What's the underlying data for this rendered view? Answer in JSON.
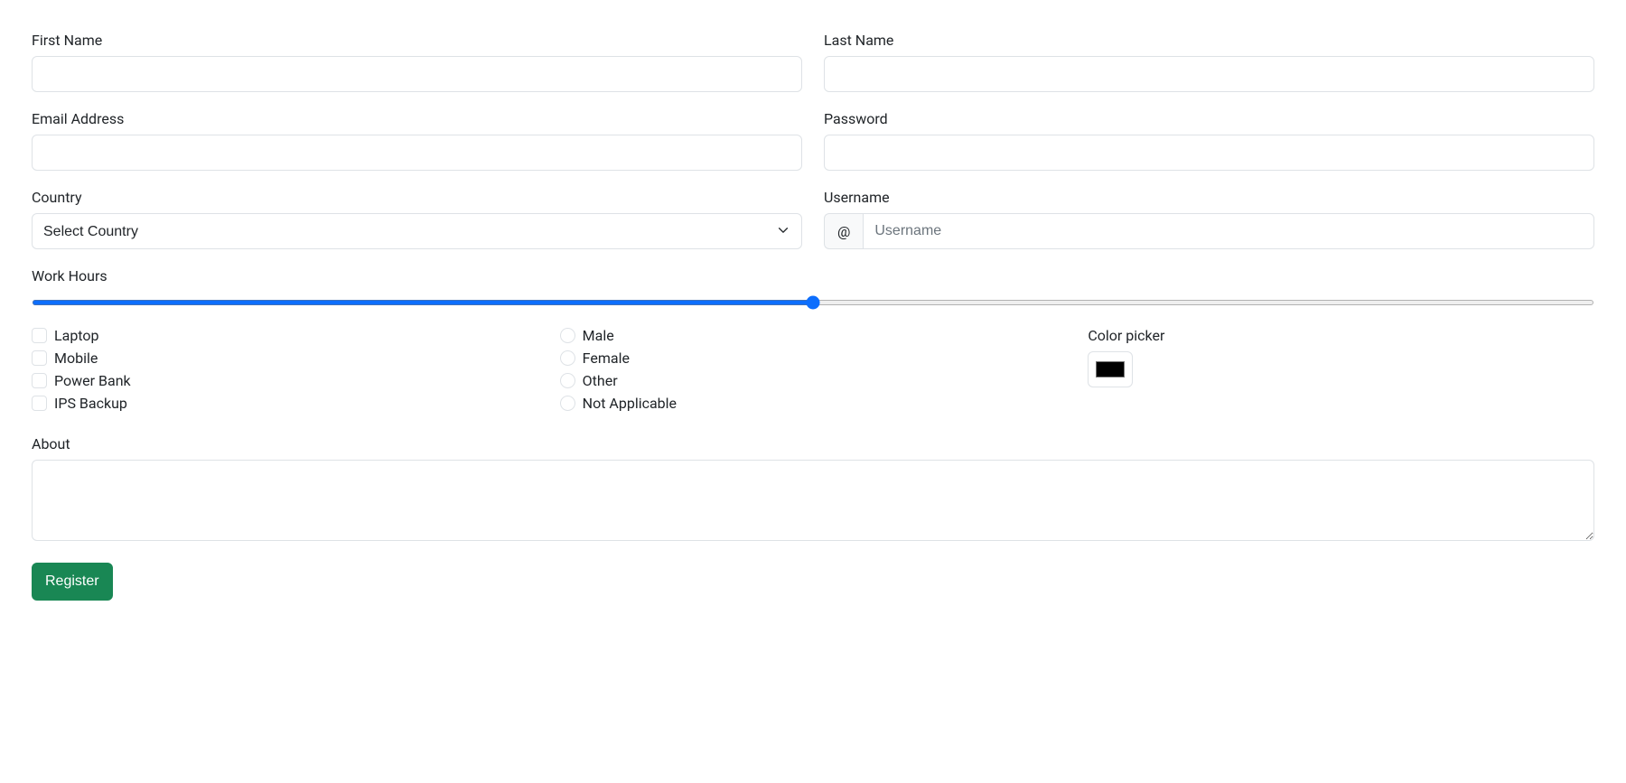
{
  "labels": {
    "first_name": "First Name",
    "last_name": "Last Name",
    "email": "Email Address",
    "password": "Password",
    "country": "Country",
    "username": "Username",
    "work_hours": "Work Hours",
    "color_picker": "Color picker",
    "about": "About"
  },
  "values": {
    "first_name": "",
    "last_name": "",
    "email": "",
    "password": "",
    "username": "",
    "work_hours": "50",
    "color": "#000000",
    "about": ""
  },
  "country": {
    "selected": "Select Country"
  },
  "username_prefix": "@",
  "username_placeholder": "Username",
  "checkboxes": {
    "laptop": "Laptop",
    "mobile": "Mobile",
    "power_bank": "Power Bank",
    "ips_backup": "IPS Backup"
  },
  "radios": {
    "male": "Male",
    "female": "Female",
    "other": "Other",
    "not_applicable": "Not Applicable"
  },
  "buttons": {
    "register": "Register"
  }
}
